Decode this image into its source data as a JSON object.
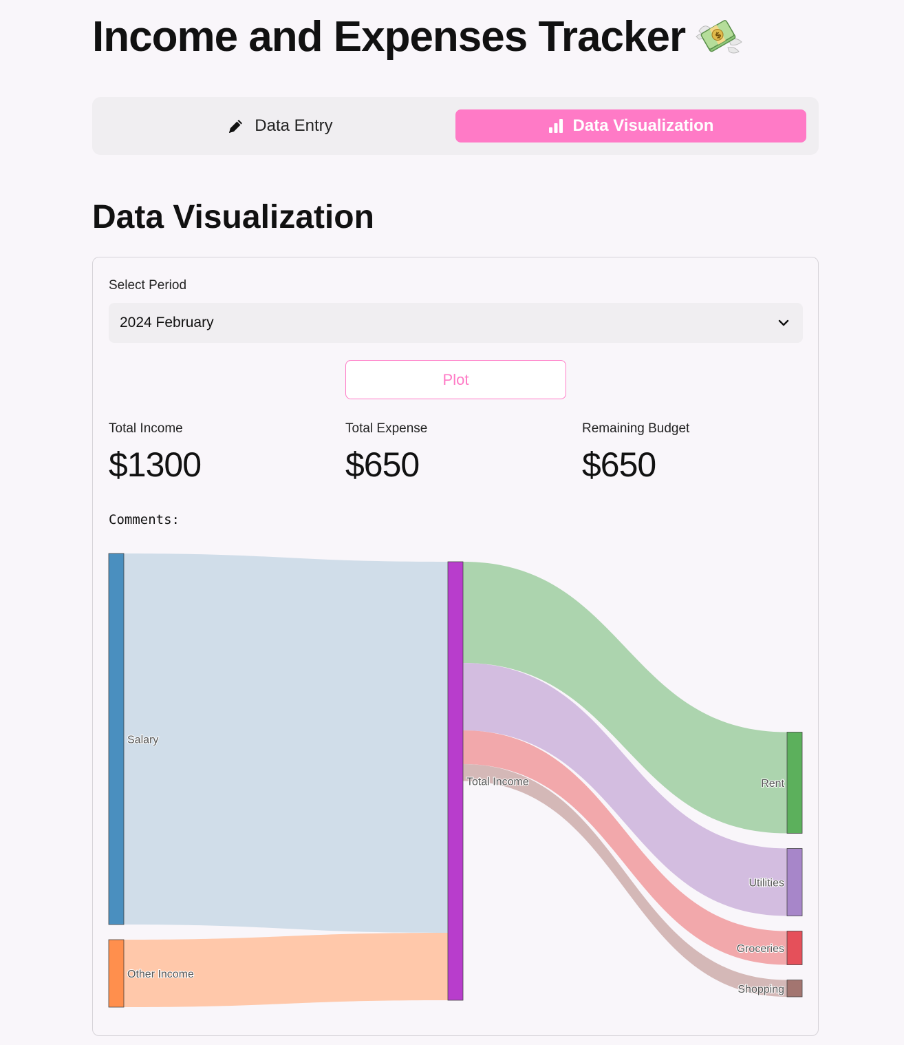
{
  "app": {
    "title": "Income and Expenses Tracker"
  },
  "tabs": [
    {
      "label": "Data Entry",
      "icon": "pencil-icon",
      "active": false
    },
    {
      "label": "Data Visualization",
      "icon": "bar-chart-icon",
      "active": true
    }
  ],
  "section": {
    "title": "Data Visualization"
  },
  "form": {
    "period_label": "Select Period",
    "period_value": "2024 February",
    "plot_label": "Plot"
  },
  "metrics": [
    {
      "label": "Total Income",
      "value": "$1300"
    },
    {
      "label": "Total Expense",
      "value": "$650"
    },
    {
      "label": "Remaining Budget",
      "value": "$650"
    }
  ],
  "comments_label": "Comments:",
  "colors": {
    "accent": "#ff7ac6",
    "tab_bg": "#f0eef1",
    "page_bg": "#f9f6fa"
  },
  "chart_data": {
    "type": "sankey",
    "nodes": [
      {
        "label": "Salary",
        "column": 0,
        "color": "#4a8fbf"
      },
      {
        "label": "Other Income",
        "column": 0,
        "color": "#ff8f4d"
      },
      {
        "label": "Total Income",
        "column": 1,
        "color": "#b83dcc"
      },
      {
        "label": "Rent",
        "column": 2,
        "color": "#5cb05c"
      },
      {
        "label": "Utilities",
        "column": 2,
        "color": "#a786c9"
      },
      {
        "label": "Groceries",
        "column": 2,
        "color": "#e5505a"
      },
      {
        "label": "Shopping",
        "column": 2,
        "color": "#a37570"
      }
    ],
    "links": [
      {
        "source": "Salary",
        "target": "Total Income",
        "value": 1100,
        "color": "#d0dde9"
      },
      {
        "source": "Other Income",
        "target": "Total Income",
        "value": 200,
        "color": "#ffc8aa"
      },
      {
        "source": "Total Income",
        "target": "Rent",
        "value": 300,
        "color": "#acd4ae"
      },
      {
        "source": "Total Income",
        "target": "Utilities",
        "value": 200,
        "color": "#d3bde0"
      },
      {
        "source": "Total Income",
        "target": "Groceries",
        "value": 100,
        "color": "#f2a8ab"
      },
      {
        "source": "Total Income",
        "target": "Shopping",
        "value": 50,
        "color": "#d4b8b7"
      }
    ]
  }
}
